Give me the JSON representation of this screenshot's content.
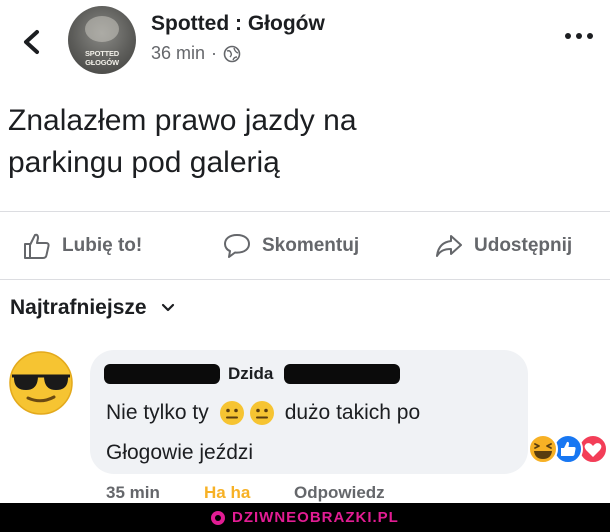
{
  "header": {
    "page_name": "Spotted : Głogów",
    "time": "36 min",
    "separator": "·",
    "avatar_text": "SPOTTED GŁOGÓW",
    "back_icon": "chevron-left-icon",
    "more_icon": "more-horizontal-icon",
    "privacy_icon": "globe-icon"
  },
  "post": {
    "text_line1": "Znalazłem prawo jazdy na",
    "text_line2": "parkingu pod galerią"
  },
  "actions": {
    "like_label": "Lubię to!",
    "comment_label": "Skomentuj",
    "share_label": "Udostępnij"
  },
  "comments": {
    "sort_label": "Najtrafniejsze",
    "items": [
      {
        "author": "Dzida",
        "text_line1_a": "Nie tylko ty",
        "text_line1_b": "dużo takich po",
        "text_line2": "Głogowie jeździ",
        "time": "35 min",
        "reaction_label": "Ha ha",
        "reply_label": "Odpowiedz",
        "emojis": [
          "neutral-face-icon",
          "neutral-face-icon"
        ],
        "reaction_icons": [
          "haha-reaction-icon",
          "like-reaction-icon",
          "love-reaction-icon"
        ]
      }
    ]
  },
  "watermark": {
    "text": "DZIWNEOBRAZKI.PL"
  },
  "colors": {
    "text": "#1c1e21",
    "secondary": "#65676b",
    "bubble": "#f0f2f5",
    "haha_orange": "#f7b125",
    "like_blue": "#1877f2",
    "love_red": "#f33e58",
    "watermark_pink": "#e21c93"
  }
}
